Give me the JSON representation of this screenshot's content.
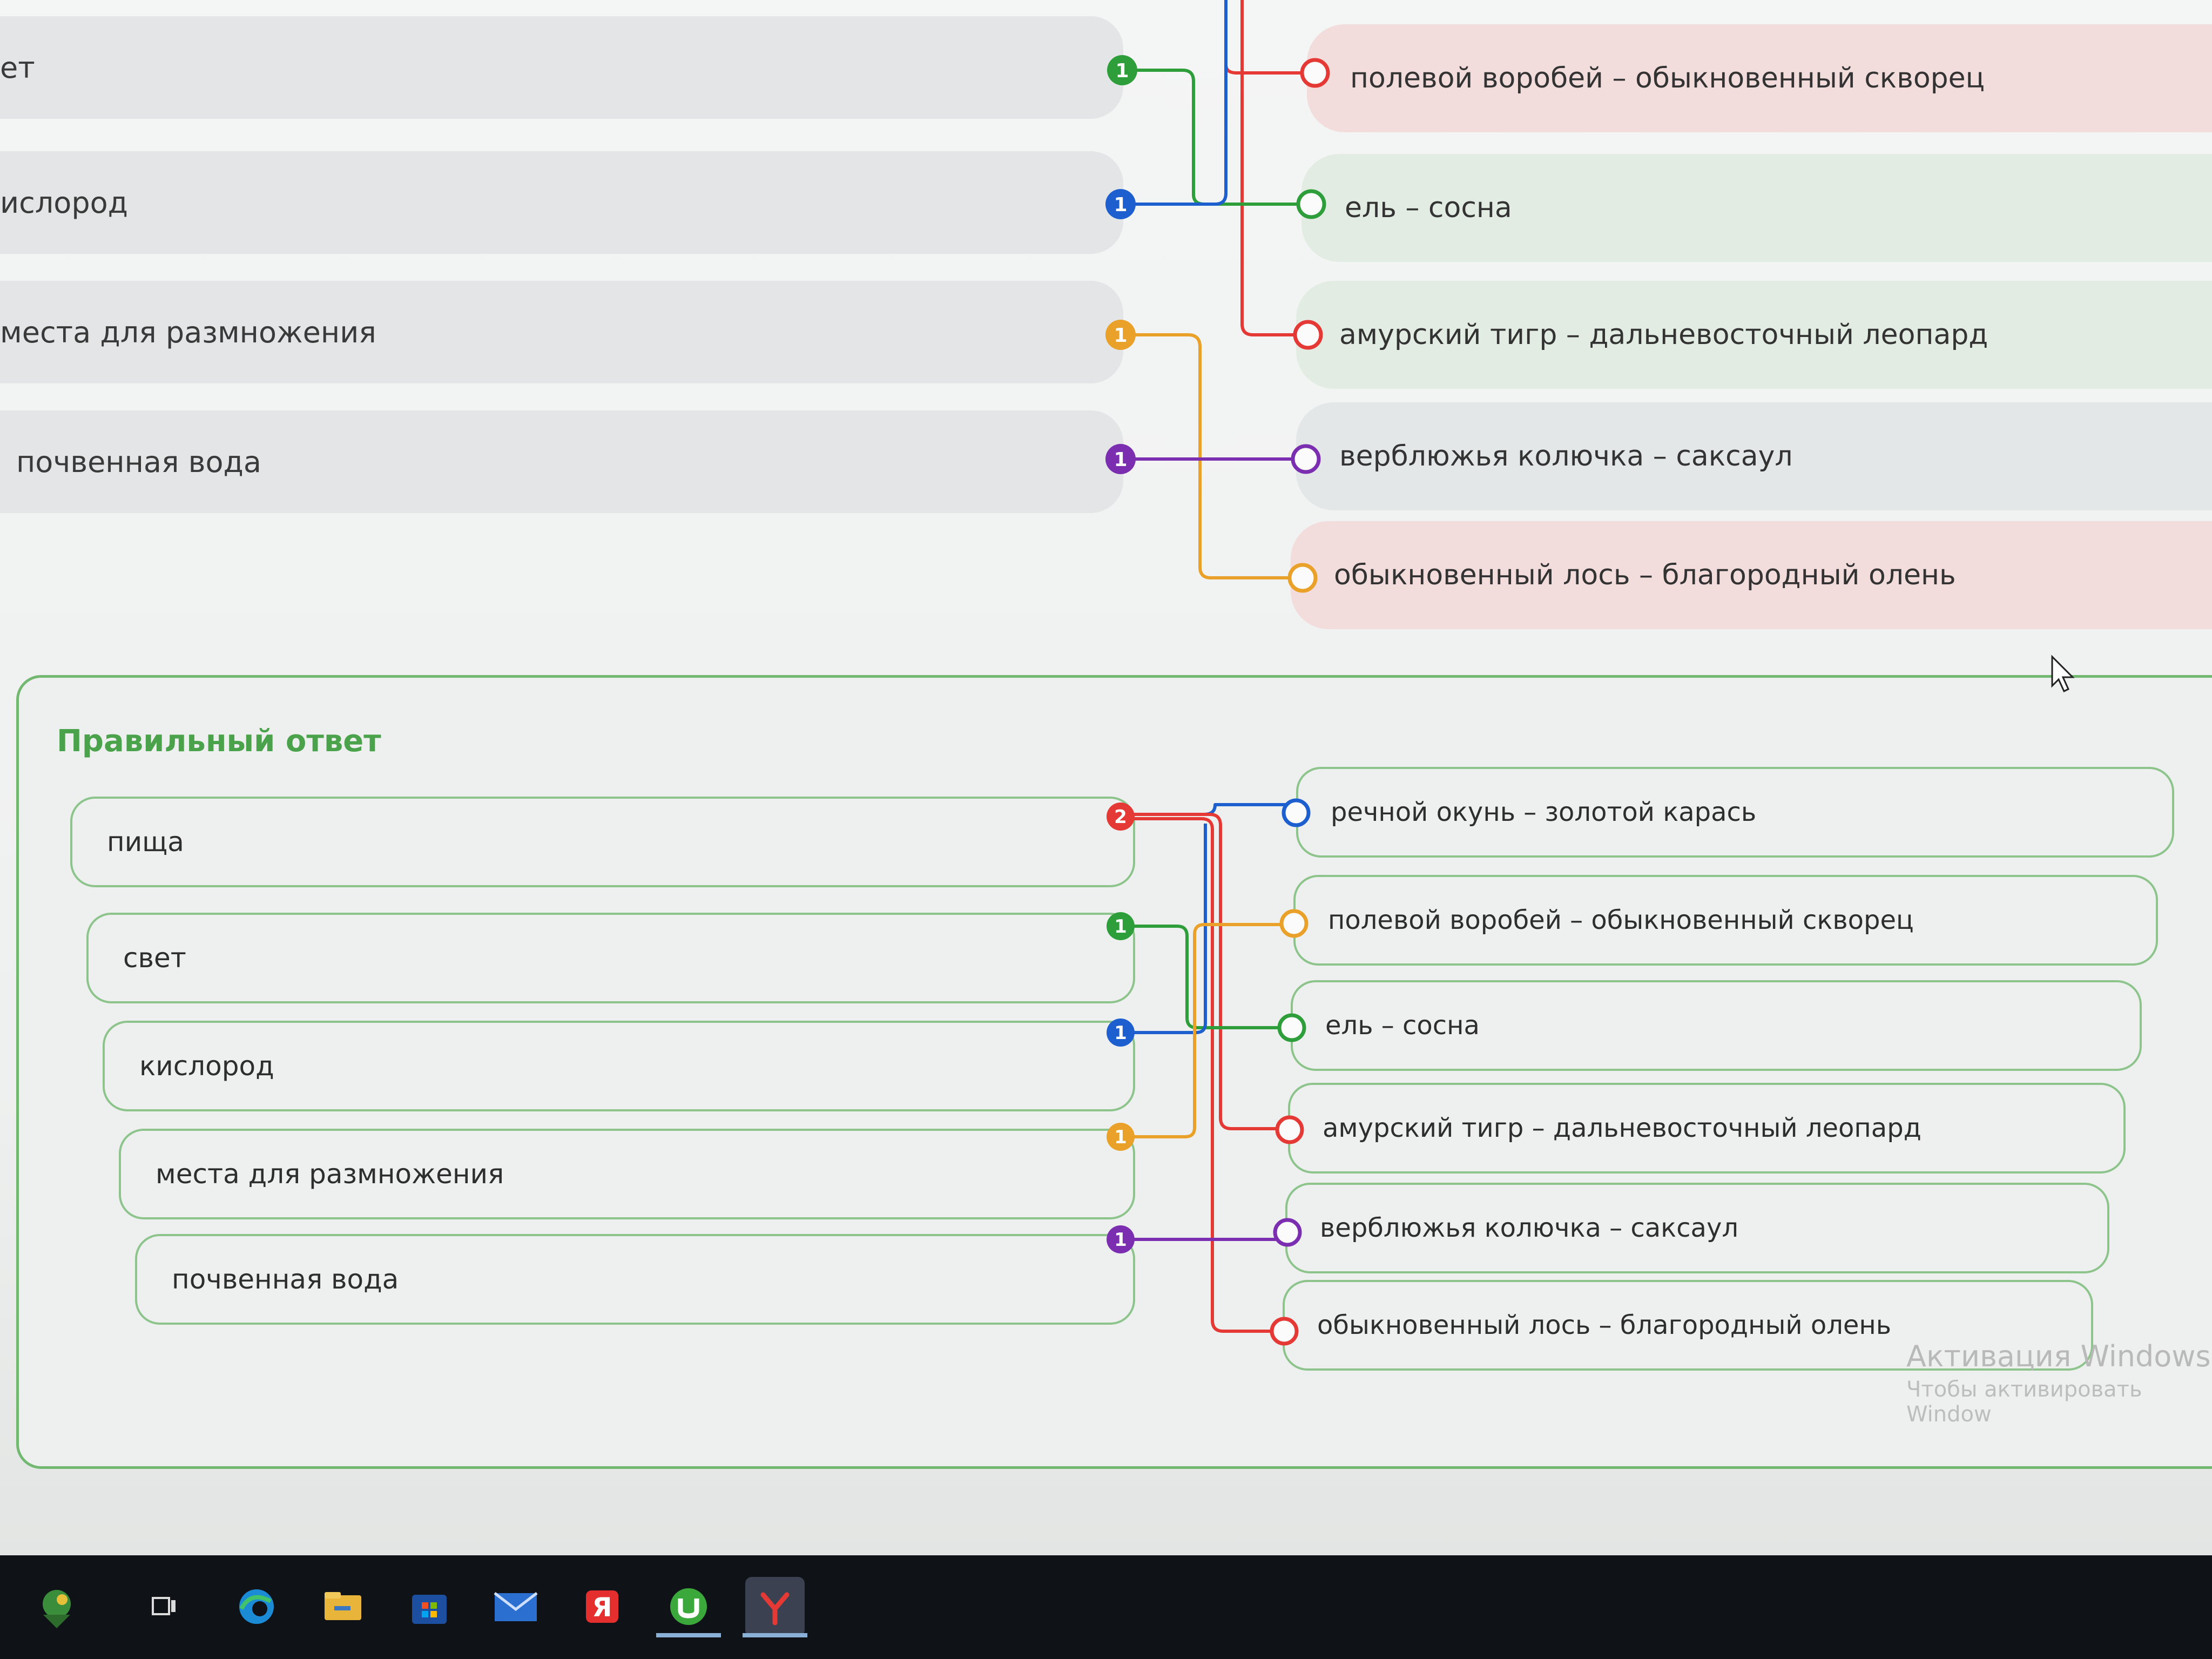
{
  "upper": {
    "left": [
      {
        "label": "ет"
      },
      {
        "label": "ислород"
      },
      {
        "label": "места для размножения"
      },
      {
        "label": "почвенная вода"
      }
    ],
    "right": [
      {
        "label": "полевой воробей – обыкновенный скворец",
        "state": "wrong"
      },
      {
        "label": "ель – сосна",
        "state": "ok"
      },
      {
        "label": "амурский тигр – дальневосточный леопард",
        "state": "neutral"
      },
      {
        "label": "верблюжья колючка – саксаул",
        "state": "neutral"
      },
      {
        "label": "обыкновенный лось – благородный олень",
        "state": "wrong"
      }
    ],
    "badges": [
      "1",
      "1",
      "1",
      "1"
    ]
  },
  "answer": {
    "title": "Правильный ответ",
    "left": [
      {
        "label": "пища",
        "badge": "2"
      },
      {
        "label": "свет",
        "badge": "1"
      },
      {
        "label": "кислород",
        "badge": "1"
      },
      {
        "label": "места для размножения",
        "badge": "1"
      },
      {
        "label": "почвенная вода",
        "badge": "1"
      }
    ],
    "right": [
      {
        "label": "речной окунь – золотой карась"
      },
      {
        "label": "полевой воробей – обыкновенный скворец"
      },
      {
        "label": "ель – сосна"
      },
      {
        "label": "амурский тигр – дальневосточный леопард"
      },
      {
        "label": "верблюжья колючка – саксаул"
      },
      {
        "label": "обыкновенный лось – благородный олень"
      }
    ]
  },
  "colors": {
    "red": "#e53935",
    "green": "#2e9e3a",
    "blue": "#1e5fd0",
    "orange": "#e9a12a",
    "purple": "#7b2fb0",
    "accent_green": "#4aa24a"
  },
  "watermark": {
    "line1": "Активация Windows",
    "line2": "Чтобы активировать Window"
  },
  "taskbar": {
    "icons": [
      "bird-app-icon",
      "task-view-icon",
      "edge-icon",
      "file-explorer-icon",
      "store-icon",
      "mail-icon",
      "yandex-browser-icon",
      "utorrent-icon",
      "yandex-icon"
    ]
  }
}
